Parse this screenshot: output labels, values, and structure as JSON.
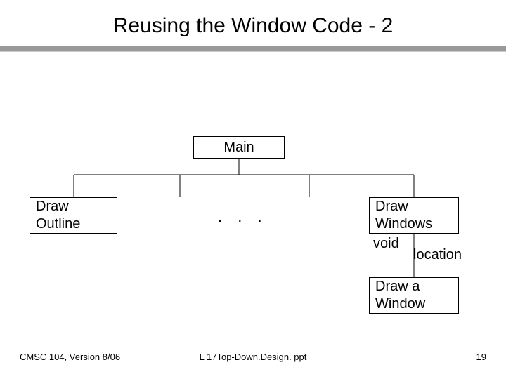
{
  "title": "Reusing the Window Code - 2",
  "nodes": {
    "main": "Main",
    "draw_outline": "Draw\nOutline",
    "dots": ".   .   .",
    "draw_windows": "Draw\nWindows",
    "void_label": "void",
    "location_label": "location",
    "draw_a_window": "Draw a\nWindow"
  },
  "footer": {
    "left": "CMSC 104, Version 8/06",
    "center": "L 17Top-Down.Design. ppt",
    "right": "19"
  }
}
